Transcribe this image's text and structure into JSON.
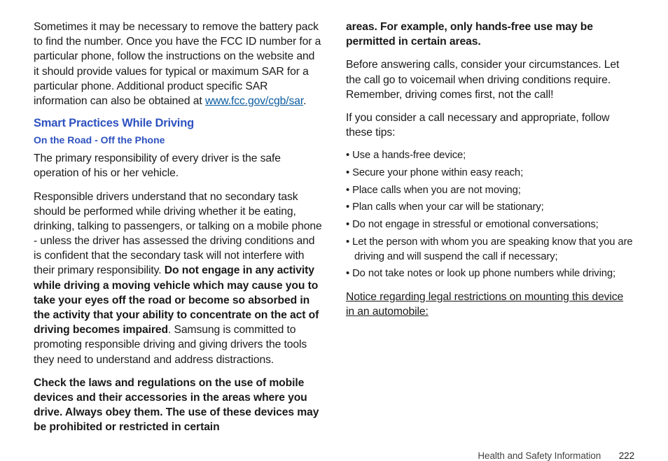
{
  "left": {
    "intro_pre": "Sometimes it may be necessary to remove the battery pack to find the number. Once you have the FCC ID number for a particular phone, follow the instructions on the website and it should provide values for typical or maximum SAR for a particular phone. Additional product specific SAR information can also be obtained at ",
    "intro_link": "www.fcc.gov/cgb/sar",
    "intro_post": ".",
    "heading": "Smart Practices While Driving",
    "subheading": "On the Road - Off the Phone",
    "p1": "The primary responsibility of every driver is the safe operation of his or her vehicle.",
    "p2_pre": "Responsible drivers understand that no secondary task should be performed while driving whether it be eating, drinking, talking to passengers, or talking on a mobile phone - unless the driver has assessed the driving conditions and is confident that the secondary task will not interfere with their primary responsibility. ",
    "p2_bold": "Do not engage in any activity while driving a moving vehicle which may cause you to take your eyes off the road or become so absorbed in the activity that your ability to concentrate on the act of driving becomes impaired",
    "p2_post": ". Samsung is committed to promoting responsible driving and giving drivers the tools they need to understand and address distractions.",
    "p3_bold": "Check the laws and regulations on the use of mobile devices and their accessories in the areas where you drive. Always obey them. The use of these devices may be prohibited or restricted in certain"
  },
  "right": {
    "cont_bold": "areas. For example, only hands-free use may be permitted in certain areas.",
    "p4": "Before answering calls, consider your circumstances. Let the call go to voicemail when driving conditions require. Remember, driving comes first, not the call!",
    "p5": "If you consider a call necessary and appropriate, follow these tips:",
    "bullets": [
      "Use a hands-free device;",
      "Secure your phone within easy reach;",
      "Place calls when you are not moving;",
      "Plan calls when your car will be stationary;",
      "Do not engage in stressful or emotional conversations;",
      "Let the person with whom you are speaking know that you are driving and will suspend the call if necessary;",
      "Do not take notes or look up phone numbers while driving;"
    ],
    "notice": "Notice regarding legal restrictions on mounting this device in an automobile:"
  },
  "footer": {
    "section": "Health and Safety Information",
    "page": "222"
  }
}
